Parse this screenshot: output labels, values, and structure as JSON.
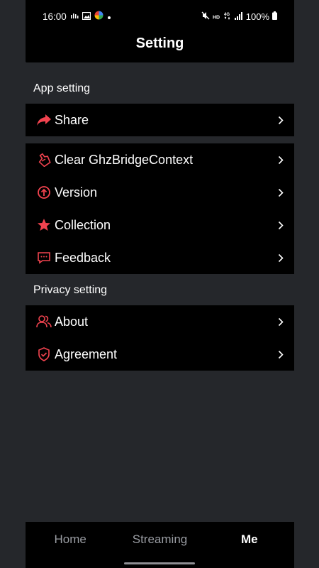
{
  "status_bar": {
    "time": "16:00",
    "left_icons": [
      "signal-activity-icon",
      "image-icon",
      "app-logo-icon",
      "dot-icon"
    ],
    "right_icons": [
      "mute-icon",
      "hd-icon",
      "4g-signal-icon",
      "signal-bars-icon"
    ],
    "battery": "100%"
  },
  "header": {
    "title": "Setting"
  },
  "sections": {
    "app_setting_label": "App setting",
    "privacy_setting_label": "Privacy setting"
  },
  "app_items": [
    {
      "label": "Share",
      "icon": "share-icon"
    },
    {
      "label": "Clear GhzBridgeContext",
      "icon": "clear-icon"
    },
    {
      "label": "Version",
      "icon": "version-icon"
    },
    {
      "label": "Collection",
      "icon": "star-icon"
    },
    {
      "label": "Feedback",
      "icon": "feedback-icon"
    }
  ],
  "privacy_items": [
    {
      "label": "About",
      "icon": "users-icon"
    },
    {
      "label": "Agreement",
      "icon": "shield-icon"
    }
  ],
  "bottom_nav": {
    "home": "Home",
    "streaming": "Streaming",
    "me": "Me",
    "active": "me"
  },
  "colors": {
    "accent": "#f2434f",
    "background": "#25272b",
    "card": "#000000",
    "inactive_text": "#9a9da3"
  }
}
